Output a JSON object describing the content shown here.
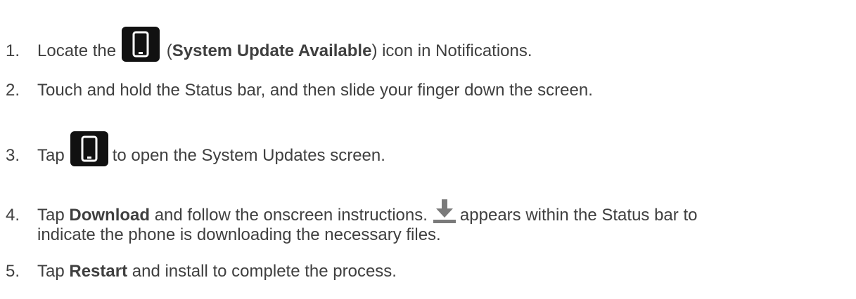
{
  "steps": [
    {
      "number": "1.",
      "pre": "Locate the",
      "icon": "system-update-icon",
      "paren_open": " (",
      "bold": "System Update Available",
      "post": ") icon in Notifications."
    },
    {
      "number": "2.",
      "text": "Touch and hold the Status bar, and then slide your finger down the screen."
    },
    {
      "number": "3.",
      "pre": "Tap",
      "icon": "system-update-icon",
      "post": "to open the System Updates screen."
    },
    {
      "number": "4.",
      "pre": "Tap ",
      "bold": "Download",
      "mid": " and follow the onscreen instructions.",
      "icon": "download-icon",
      "post": "appears within the Status bar to",
      "line2": "indicate the phone is downloading the necessary files."
    },
    {
      "number": "5.",
      "pre": "Tap ",
      "bold": "Restart",
      "post": " and install to complete the process."
    }
  ],
  "colors": {
    "text": "#3f3f3f",
    "icon_bg": "#111111",
    "download_icon": "#7a7a7a"
  }
}
